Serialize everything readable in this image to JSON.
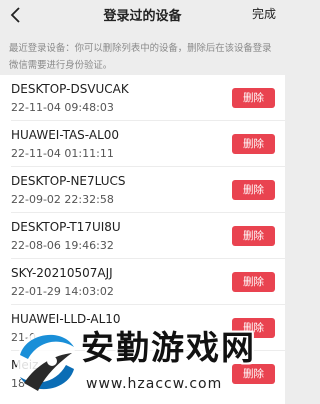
{
  "header": {
    "title": "登录过的设备",
    "done_label": "完成"
  },
  "description": "最近登录设备：你可以删除列表中的设备，删除后在该设备登录微信需要进行身份验证。",
  "devices": [
    {
      "name": "DESKTOP-DSVUCAK",
      "time": "22-11-04 09:48:03",
      "delete_label": "删除"
    },
    {
      "name": "HUAWEI-TAS-AL00",
      "time": "22-11-04 01:11:11",
      "delete_label": "删除"
    },
    {
      "name": "DESKTOP-NE7LUCS",
      "time": "22-09-02 22:32:58",
      "delete_label": "删除"
    },
    {
      "name": "DESKTOP-T17UI8U",
      "time": "22-08-06 19:46:32",
      "delete_label": "删除"
    },
    {
      "name": "SKY-20210507AJJ",
      "time": "22-01-29 14:03:02",
      "delete_label": "删除"
    },
    {
      "name": "HUAWEI-LLD-AL10",
      "time": "21-0",
      "delete_label": "删除"
    },
    {
      "name": "Meiz",
      "time": "18-0",
      "delete_label": "删除"
    }
  ],
  "watermark": {
    "title": "安勤游戏网",
    "url": "www.hzaccw.com"
  },
  "colors": {
    "delete_button": "#e94350",
    "background": "#ededed",
    "list_background": "#ffffff"
  }
}
